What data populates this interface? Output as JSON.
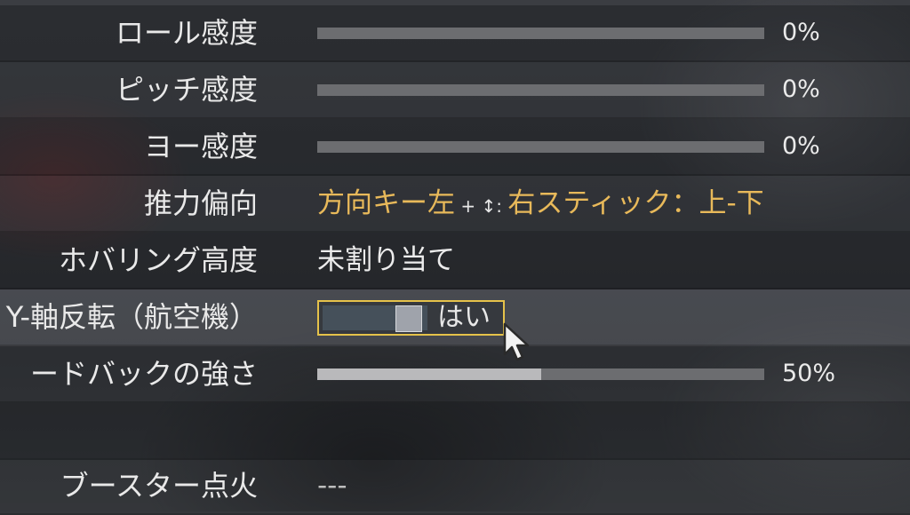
{
  "settings": {
    "roll": {
      "label": "ロール感度",
      "value_text": "0%",
      "fraction": 0
    },
    "pitch": {
      "label": "ピッチ感度",
      "value_text": "0%",
      "fraction": 0
    },
    "yaw": {
      "label": "ヨー感度",
      "value_text": "0%",
      "fraction": 0
    },
    "thrust": {
      "label": "推力偏向",
      "binding_primary": "方向キー左",
      "binding_sep": " + ↕: ",
      "binding_secondary": "右スティック：上-下"
    },
    "hover": {
      "label": "ホバリング高度",
      "value_text": "未割り当て"
    },
    "invert_y": {
      "label": "Y-軸反転（航空機）",
      "value_text": "はい"
    },
    "feedback": {
      "label": "ードバックの強さ",
      "value_text": "50%",
      "fraction": 0.5
    },
    "booster": {
      "label": "ブースター点火",
      "value_text": "---"
    }
  },
  "colors": {
    "accent_gold": "#e8b95a",
    "focus_border": "#e5c24a"
  },
  "icons": {
    "cursor": "mouse-pointer-icon",
    "updown": "up-down-arrow-icon"
  }
}
